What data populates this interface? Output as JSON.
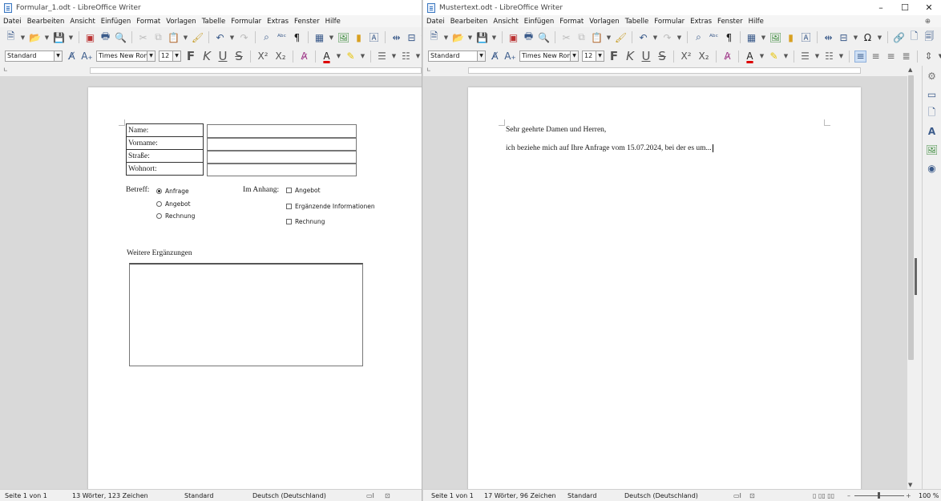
{
  "left": {
    "title": "Formular_1.odt - LibreOffice Writer",
    "menu": [
      "Datei",
      "Bearbeiten",
      "Ansicht",
      "Einfügen",
      "Format",
      "Vorlagen",
      "Tabelle",
      "Formular",
      "Extras",
      "Fenster",
      "Hilfe"
    ],
    "style": "Standard",
    "font": "Times New Roman",
    "size": "12",
    "form": {
      "fields": [
        "Name:",
        "Vorname:",
        "Straße:",
        "Wohnort:"
      ],
      "betreff_label": "Betreff:",
      "radios": [
        {
          "label": "Anfrage",
          "selected": true
        },
        {
          "label": "Angebot",
          "selected": false
        },
        {
          "label": "Rechnung",
          "selected": false
        }
      ],
      "anhang_label": "Im Anhang:",
      "checks": [
        "Angebot",
        "Ergänzende Informationen",
        "Rechnung"
      ],
      "weitere_label": "Weitere Ergänzungen"
    },
    "status": {
      "page": "Seite 1 von 1",
      "words": "13 Wörter, 123 Zeichen",
      "style": "Standard",
      "lang": "Deutsch (Deutschland)"
    }
  },
  "right": {
    "title": "Mustertext.odt - LibreOffice Writer",
    "menu": [
      "Datei",
      "Bearbeiten",
      "Ansicht",
      "Einfügen",
      "Format",
      "Vorlagen",
      "Tabelle",
      "Formular",
      "Extras",
      "Fenster",
      "Hilfe"
    ],
    "style": "Standard",
    "font": "Times New Roman",
    "size": "12",
    "body": {
      "line1": "Sehr geehrte Damen und Herren,",
      "line2": "ich beziehe mich auf Ihre Anfrage vom 15.07.2024, bei der es um..."
    },
    "status": {
      "page": "Seite 1 von 1",
      "words": "17 Wörter, 96 Zeichen",
      "style": "Standard",
      "lang": "Deutsch (Deutschland)",
      "zoom": "100 %"
    }
  },
  "window_controls": {
    "minimize": "–",
    "maximize": "☐",
    "close": "✕"
  }
}
